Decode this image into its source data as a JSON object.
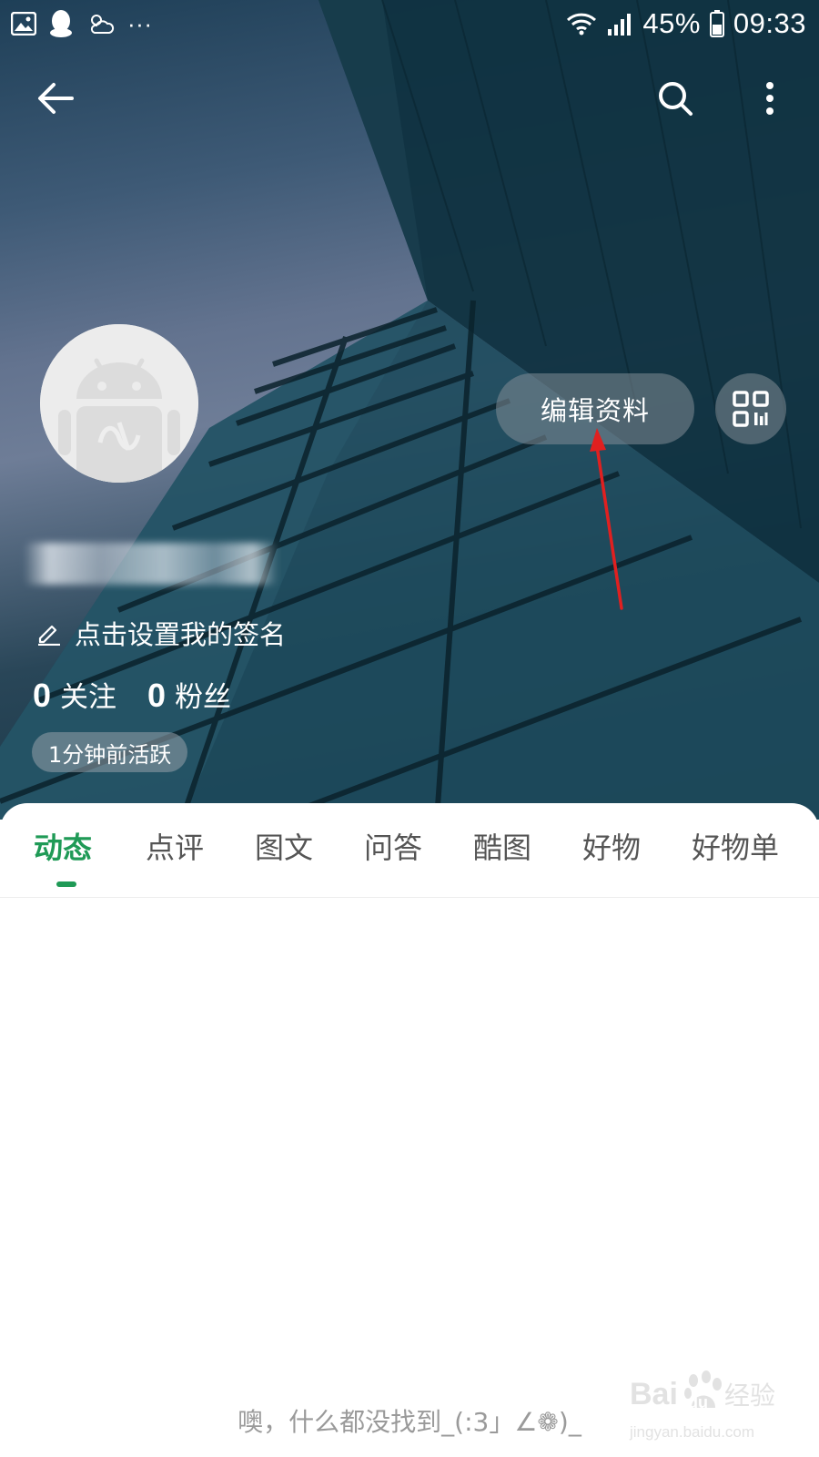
{
  "status_bar": {
    "battery": "45%",
    "time": "09:33",
    "more_dots": "···"
  },
  "top_bar": {
    "icons": [
      "back-arrow-icon",
      "search-icon",
      "more-vert-icon"
    ]
  },
  "profile": {
    "edit_profile_label": "编辑资料",
    "signature_placeholder": "点击设置我的签名",
    "following_count": "0",
    "following_label": "关注",
    "followers_count": "0",
    "followers_label": "粉丝",
    "active_status": "1分钟前活跃"
  },
  "tabs": [
    {
      "label": "动态",
      "active": true
    },
    {
      "label": "点评",
      "active": false
    },
    {
      "label": "图文",
      "active": false
    },
    {
      "label": "问答",
      "active": false
    },
    {
      "label": "酷图",
      "active": false
    },
    {
      "label": "好物",
      "active": false
    },
    {
      "label": "好物单",
      "active": false
    }
  ],
  "empty_state": "噢，什么都没找到_(:3」∠❁)_",
  "watermark": {
    "brand_top": "Bai",
    "brand_mid": "du",
    "brand_cn": "经验",
    "url": "jingyan.baidu.com"
  },
  "colors": {
    "accent_green": "#1f9a56",
    "annotation_red": "#e02020"
  }
}
